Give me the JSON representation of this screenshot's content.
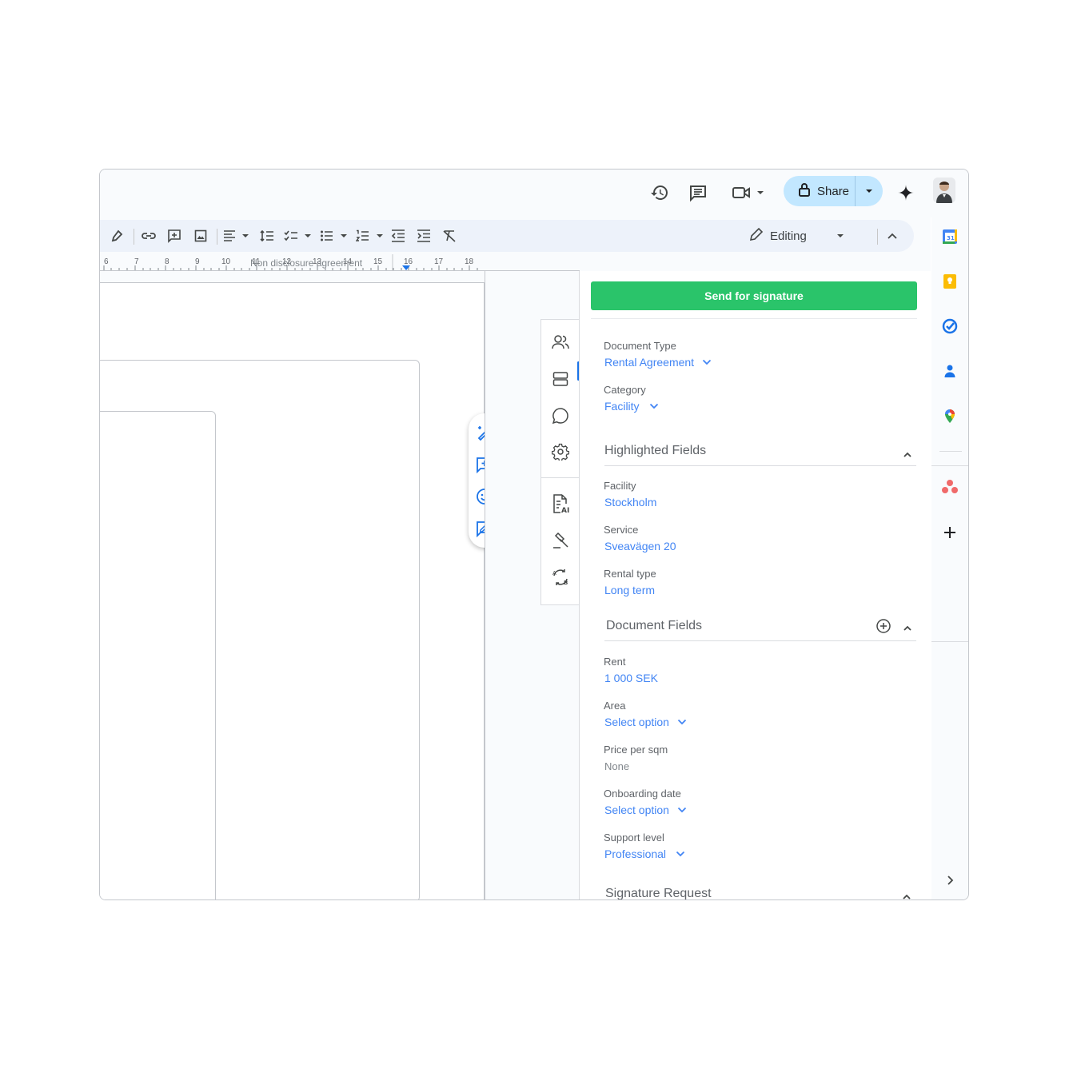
{
  "topbar": {
    "share_label": "Share"
  },
  "toolbar": {
    "editing_label": "Editing"
  },
  "ruler": {
    "numbers": [
      "6",
      "7",
      "8",
      "9",
      "10",
      "11",
      "12",
      "13",
      "14",
      "15",
      "16",
      "17",
      "18"
    ],
    "doc_title": "Non disclosure agreement"
  },
  "panel": {
    "send_label": "Send for signature",
    "document_type": {
      "label": "Document Type",
      "value": "Rental Agreement"
    },
    "category": {
      "label": "Category",
      "value": "Facility"
    },
    "highlighted": {
      "title": "Highlighted Fields",
      "facility": {
        "label": "Facility",
        "value": "Stockholm"
      },
      "service": {
        "label": "Service",
        "value": "Sveavägen 20"
      },
      "rental_type": {
        "label": "Rental type",
        "value": "Long term"
      }
    },
    "document_fields": {
      "title": "Document Fields",
      "rent": {
        "label": "Rent",
        "value": "1 000 SEK"
      },
      "area": {
        "label": "Area",
        "value": "Select option"
      },
      "price_per_sqm": {
        "label": "Price per sqm",
        "value": "None"
      },
      "onboarding_date": {
        "label": "Onboarding date",
        "value": "Select option"
      },
      "support_level": {
        "label": "Support level",
        "value": "Professional"
      }
    },
    "signature": {
      "title": "Signature Request"
    }
  },
  "colors": {
    "accent_blue": "#4285f4",
    "send_green": "#2ac46a",
    "share_bg": "#c2e7ff",
    "toolbar_bg": "#edf2fa"
  },
  "icons": {
    "topbar": [
      "history-icon",
      "comment-icon",
      "video-call-icon",
      "lock-icon",
      "gemini-sparkle-icon"
    ],
    "apps": [
      "calendar-icon",
      "keep-icon",
      "tasks-icon",
      "contacts-icon",
      "maps-icon",
      "asana-icon",
      "add-icon",
      "expand-icon"
    ]
  }
}
